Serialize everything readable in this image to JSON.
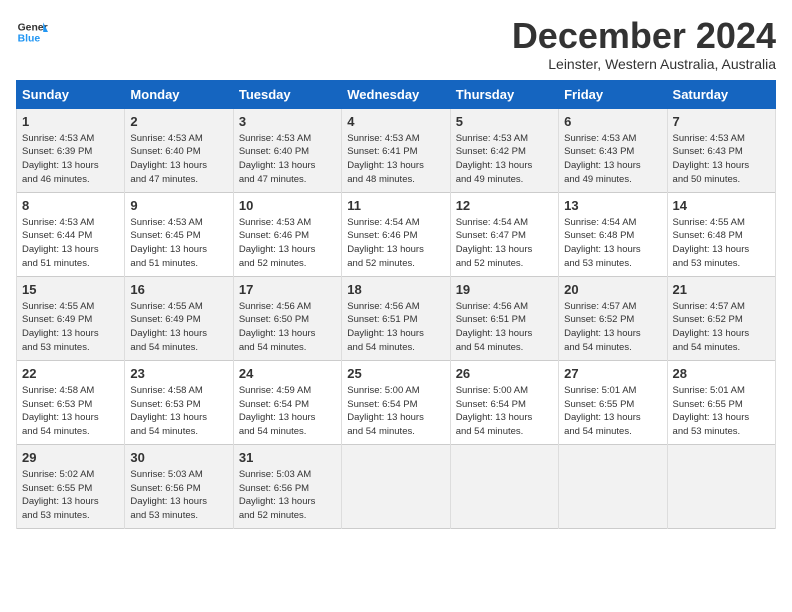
{
  "header": {
    "logo_general": "General",
    "logo_blue": "Blue",
    "month": "December 2024",
    "location": "Leinster, Western Australia, Australia"
  },
  "weekdays": [
    "Sunday",
    "Monday",
    "Tuesday",
    "Wednesday",
    "Thursday",
    "Friday",
    "Saturday"
  ],
  "weeks": [
    [
      {
        "day": "1",
        "info": "Sunrise: 4:53 AM\nSunset: 6:39 PM\nDaylight: 13 hours\nand 46 minutes."
      },
      {
        "day": "2",
        "info": "Sunrise: 4:53 AM\nSunset: 6:40 PM\nDaylight: 13 hours\nand 47 minutes."
      },
      {
        "day": "3",
        "info": "Sunrise: 4:53 AM\nSunset: 6:40 PM\nDaylight: 13 hours\nand 47 minutes."
      },
      {
        "day": "4",
        "info": "Sunrise: 4:53 AM\nSunset: 6:41 PM\nDaylight: 13 hours\nand 48 minutes."
      },
      {
        "day": "5",
        "info": "Sunrise: 4:53 AM\nSunset: 6:42 PM\nDaylight: 13 hours\nand 49 minutes."
      },
      {
        "day": "6",
        "info": "Sunrise: 4:53 AM\nSunset: 6:43 PM\nDaylight: 13 hours\nand 49 minutes."
      },
      {
        "day": "7",
        "info": "Sunrise: 4:53 AM\nSunset: 6:43 PM\nDaylight: 13 hours\nand 50 minutes."
      }
    ],
    [
      {
        "day": "8",
        "info": "Sunrise: 4:53 AM\nSunset: 6:44 PM\nDaylight: 13 hours\nand 51 minutes."
      },
      {
        "day": "9",
        "info": "Sunrise: 4:53 AM\nSunset: 6:45 PM\nDaylight: 13 hours\nand 51 minutes."
      },
      {
        "day": "10",
        "info": "Sunrise: 4:53 AM\nSunset: 6:46 PM\nDaylight: 13 hours\nand 52 minutes."
      },
      {
        "day": "11",
        "info": "Sunrise: 4:54 AM\nSunset: 6:46 PM\nDaylight: 13 hours\nand 52 minutes."
      },
      {
        "day": "12",
        "info": "Sunrise: 4:54 AM\nSunset: 6:47 PM\nDaylight: 13 hours\nand 52 minutes."
      },
      {
        "day": "13",
        "info": "Sunrise: 4:54 AM\nSunset: 6:48 PM\nDaylight: 13 hours\nand 53 minutes."
      },
      {
        "day": "14",
        "info": "Sunrise: 4:55 AM\nSunset: 6:48 PM\nDaylight: 13 hours\nand 53 minutes."
      }
    ],
    [
      {
        "day": "15",
        "info": "Sunrise: 4:55 AM\nSunset: 6:49 PM\nDaylight: 13 hours\nand 53 minutes."
      },
      {
        "day": "16",
        "info": "Sunrise: 4:55 AM\nSunset: 6:49 PM\nDaylight: 13 hours\nand 54 minutes."
      },
      {
        "day": "17",
        "info": "Sunrise: 4:56 AM\nSunset: 6:50 PM\nDaylight: 13 hours\nand 54 minutes."
      },
      {
        "day": "18",
        "info": "Sunrise: 4:56 AM\nSunset: 6:51 PM\nDaylight: 13 hours\nand 54 minutes."
      },
      {
        "day": "19",
        "info": "Sunrise: 4:56 AM\nSunset: 6:51 PM\nDaylight: 13 hours\nand 54 minutes."
      },
      {
        "day": "20",
        "info": "Sunrise: 4:57 AM\nSunset: 6:52 PM\nDaylight: 13 hours\nand 54 minutes."
      },
      {
        "day": "21",
        "info": "Sunrise: 4:57 AM\nSunset: 6:52 PM\nDaylight: 13 hours\nand 54 minutes."
      }
    ],
    [
      {
        "day": "22",
        "info": "Sunrise: 4:58 AM\nSunset: 6:53 PM\nDaylight: 13 hours\nand 54 minutes."
      },
      {
        "day": "23",
        "info": "Sunrise: 4:58 AM\nSunset: 6:53 PM\nDaylight: 13 hours\nand 54 minutes."
      },
      {
        "day": "24",
        "info": "Sunrise: 4:59 AM\nSunset: 6:54 PM\nDaylight: 13 hours\nand 54 minutes."
      },
      {
        "day": "25",
        "info": "Sunrise: 5:00 AM\nSunset: 6:54 PM\nDaylight: 13 hours\nand 54 minutes."
      },
      {
        "day": "26",
        "info": "Sunrise: 5:00 AM\nSunset: 6:54 PM\nDaylight: 13 hours\nand 54 minutes."
      },
      {
        "day": "27",
        "info": "Sunrise: 5:01 AM\nSunset: 6:55 PM\nDaylight: 13 hours\nand 54 minutes."
      },
      {
        "day": "28",
        "info": "Sunrise: 5:01 AM\nSunset: 6:55 PM\nDaylight: 13 hours\nand 53 minutes."
      }
    ],
    [
      {
        "day": "29",
        "info": "Sunrise: 5:02 AM\nSunset: 6:55 PM\nDaylight: 13 hours\nand 53 minutes."
      },
      {
        "day": "30",
        "info": "Sunrise: 5:03 AM\nSunset: 6:56 PM\nDaylight: 13 hours\nand 53 minutes."
      },
      {
        "day": "31",
        "info": "Sunrise: 5:03 AM\nSunset: 6:56 PM\nDaylight: 13 hours\nand 52 minutes."
      },
      {
        "day": "",
        "info": ""
      },
      {
        "day": "",
        "info": ""
      },
      {
        "day": "",
        "info": ""
      },
      {
        "day": "",
        "info": ""
      }
    ]
  ]
}
